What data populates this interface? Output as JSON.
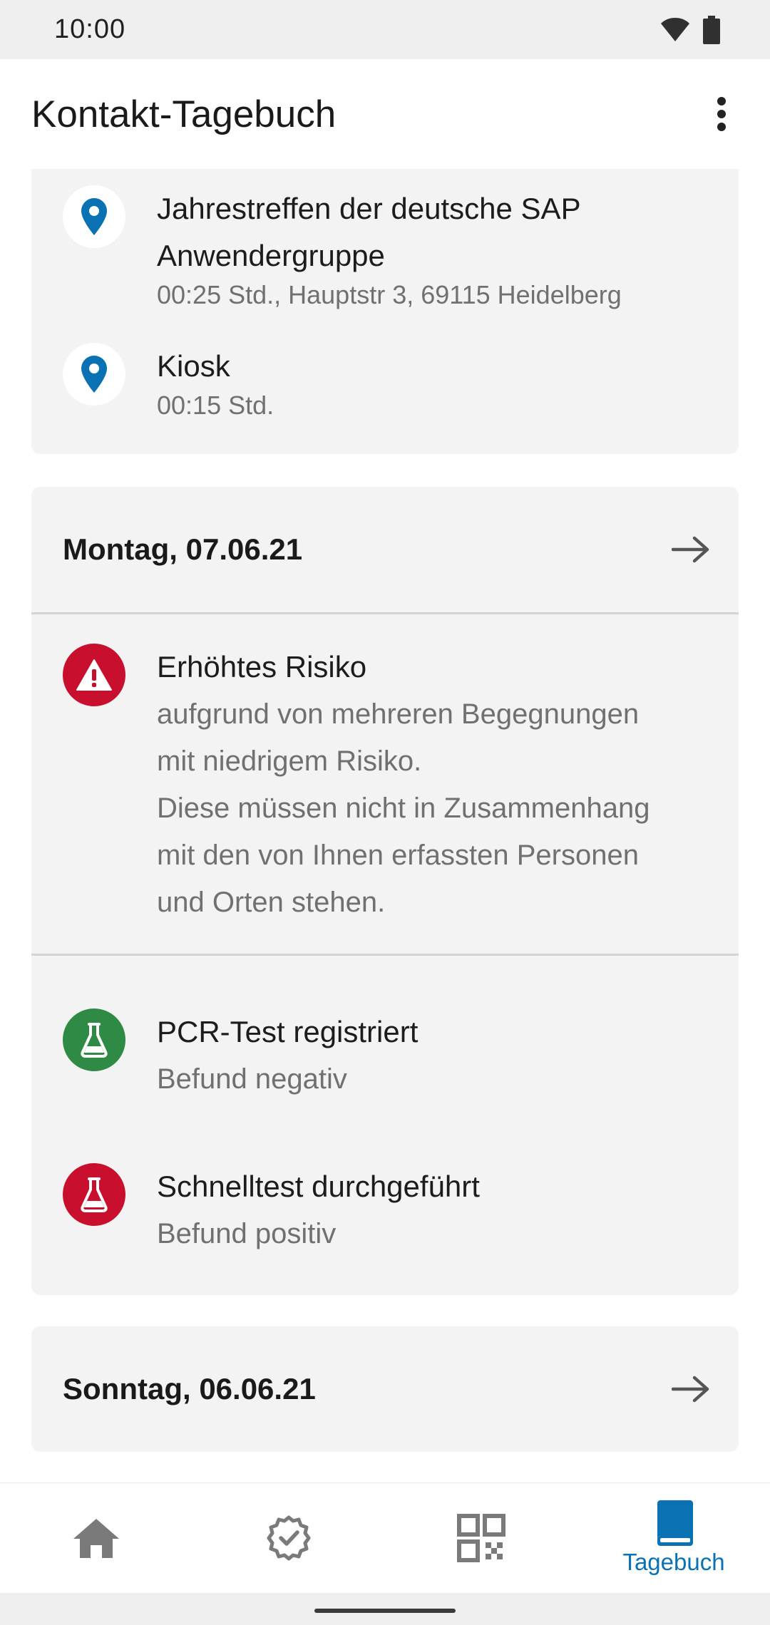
{
  "status_bar": {
    "time": "10:00"
  },
  "app_bar": {
    "title": "Kontakt-Tagebuch"
  },
  "locations": [
    {
      "title_line1": "Jahrestreffen der deutsche SAP",
      "title_line2": "Anwendergruppe",
      "detail": "00:25 Std., Hauptstr 3, 69115 Heidelberg"
    },
    {
      "title_line1": "Kiosk",
      "detail": "00:15 Std."
    }
  ],
  "day1": {
    "label": "Montag, 07.06.21",
    "risk": {
      "title": "Erhöhtes Risiko",
      "lines": [
        "aufgrund von mehreren Begegnungen",
        "mit niedrigem Risiko.",
        "Diese müssen nicht in Zusammenhang",
        "mit den von Ihnen erfassten Personen",
        "und Orten stehen."
      ]
    },
    "tests": [
      {
        "title": "PCR-Test registriert",
        "result": "Befund negativ",
        "color": "#2e8a45"
      },
      {
        "title": "Schnelltest durchgeführt",
        "result": "Befund positiv",
        "color": "#c8102e"
      }
    ]
  },
  "day2": {
    "label": "Sonntag, 06.06.21"
  },
  "bottom_nav": {
    "items": [
      {
        "icon": "home-icon"
      },
      {
        "icon": "certificate-icon"
      },
      {
        "icon": "qr-code-icon"
      },
      {
        "icon": "diary-book-icon",
        "label": "Tagebuch",
        "active": true
      }
    ]
  },
  "colors": {
    "accent": "#0a72b2",
    "risk_red": "#c8102e",
    "negative_green": "#2e8a45",
    "card_bg": "#f3f3f3"
  }
}
